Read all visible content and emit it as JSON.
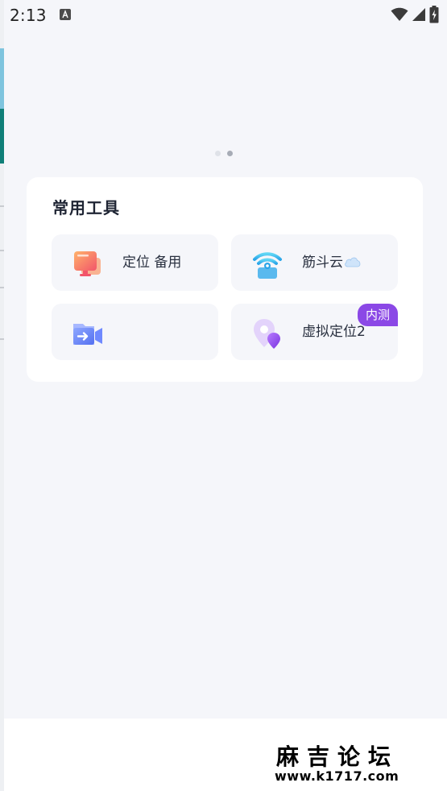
{
  "status_bar": {
    "time": "2:13",
    "notification_icon": "text-a-icon",
    "icons": [
      "wifi-icon",
      "signal-icon",
      "battery-charging-icon"
    ]
  },
  "pager": {
    "count": 2,
    "active_index": 1
  },
  "tools": {
    "title": "常用工具",
    "items": [
      {
        "label": "定位 备用",
        "icon": "screens-icon"
      },
      {
        "label": "筋斗云",
        "icon": "wifi-badge-icon",
        "suffix_icon": "cloud-icon"
      },
      {
        "label": "",
        "icon": "video-folder-icon"
      },
      {
        "label": "虚拟定位2",
        "icon": "location-pin-icon",
        "badge": "内测"
      }
    ]
  },
  "watermark": {
    "title": "麻吉论坛",
    "url": "www.k1717.com"
  },
  "colors": {
    "background": "#f5f6fa",
    "card": "#ffffff",
    "badge": "#8b48e6"
  }
}
